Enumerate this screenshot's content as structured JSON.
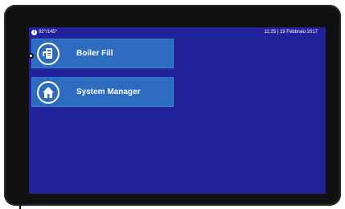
{
  "status_bar": {
    "left_text": "92°/145°",
    "right_text": "11:25 | 19 Febbraio 2017"
  },
  "menu": {
    "items": [
      {
        "label": "Boiler Fill",
        "icon": "boiler-fill-icon"
      },
      {
        "label": "System Manager",
        "icon": "home-icon"
      }
    ]
  },
  "colors": {
    "screen_bg": "#22239a",
    "tile_bg": "#2d6cbf",
    "bezel": "#111111"
  }
}
